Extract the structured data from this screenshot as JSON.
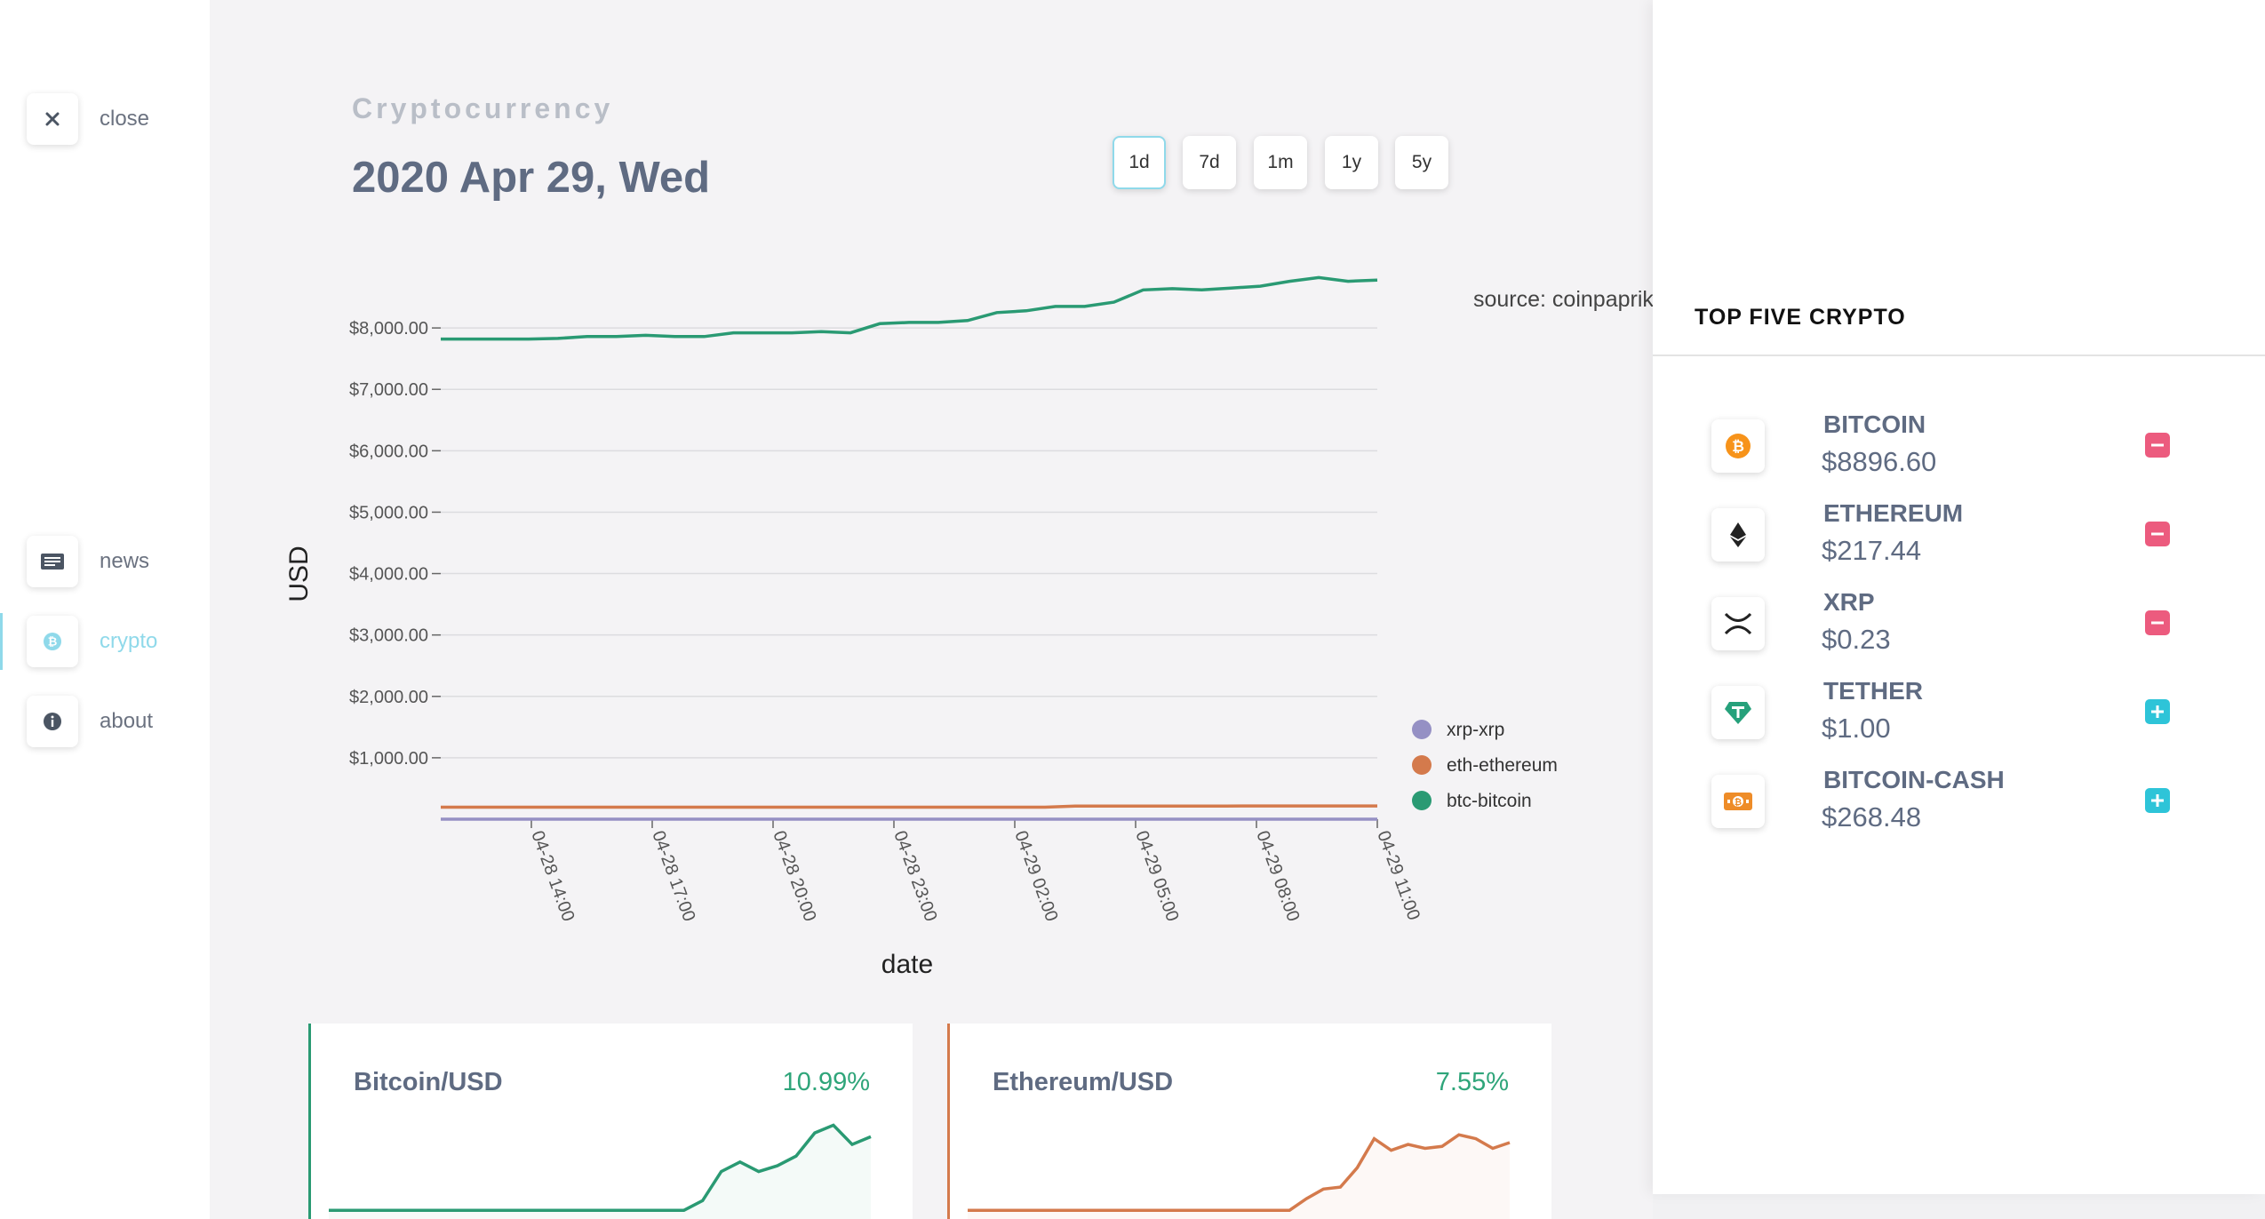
{
  "nav": {
    "close_label": "close",
    "items": [
      {
        "label": "news",
        "icon": "newspaper-icon"
      },
      {
        "label": "crypto",
        "icon": "bitcoin-icon",
        "active": true
      },
      {
        "label": "about",
        "icon": "info-icon"
      }
    ]
  },
  "header": {
    "section": "Cryptocurrency",
    "date": "2020 Apr 29, Wed"
  },
  "ranges": [
    "1d",
    "7d",
    "1m",
    "1y",
    "5y"
  ],
  "active_range": "1d",
  "chart_data": {
    "type": "line",
    "title": "",
    "source": "source: coinpaprika",
    "xlabel": "date",
    "ylabel": "USD",
    "yticks": [
      "$1,000.00",
      "$2,000.00",
      "$3,000.00",
      "$4,000.00",
      "$5,000.00",
      "$6,000.00",
      "$7,000.00",
      "$8,000.00"
    ],
    "ylim": [
      0,
      9000
    ],
    "xticks": [
      "04-28 14:00",
      "04-28 17:00",
      "04-28 20:00",
      "04-28 23:00",
      "04-29 02:00",
      "04-29 05:00",
      "04-29 08:00",
      "04-29 11:00"
    ],
    "grid": true,
    "legend_position": "right",
    "x_hours": [
      0,
      1,
      2,
      3,
      4,
      5,
      6,
      7,
      8,
      9,
      10,
      11,
      12,
      13,
      14,
      15,
      16,
      17,
      18,
      19,
      20,
      21,
      22,
      23,
      24,
      25,
      26,
      27,
      28,
      29,
      30,
      31
    ],
    "series": [
      {
        "name": "xrp-xrp",
        "color": "#9590c4",
        "values": [
          0.2,
          0.2,
          0.2,
          0.2,
          0.2,
          0.2,
          0.2,
          0.2,
          0.2,
          0.2,
          0.2,
          0.2,
          0.2,
          0.2,
          0.2,
          0.2,
          0.2,
          0.2,
          0.2,
          0.2,
          0.2,
          0.2,
          0.2,
          0.23,
          0.23,
          0.23,
          0.23,
          0.23,
          0.23,
          0.23,
          0.23,
          0.23
        ]
      },
      {
        "name": "eth-ethereum",
        "color": "#d47a4c",
        "values": [
          195,
          195,
          195,
          195,
          195,
          195,
          195,
          195,
          195,
          195,
          195,
          195,
          195,
          195,
          195,
          195,
          195,
          195,
          195,
          195,
          196,
          212,
          214,
          214,
          214,
          214,
          214,
          215,
          215,
          215,
          215,
          216
        ]
      },
      {
        "name": "btc-bitcoin",
        "color": "#2a9a73",
        "values": [
          7820,
          7820,
          7820,
          7820,
          7830,
          7860,
          7860,
          7880,
          7860,
          7860,
          7920,
          7920,
          7920,
          7940,
          7920,
          8070,
          8090,
          8090,
          8120,
          8250,
          8280,
          8350,
          8350,
          8420,
          8620,
          8640,
          8620,
          8650,
          8680,
          8760,
          8820,
          8760,
          8780
        ]
      }
    ]
  },
  "cards": [
    {
      "title": "Bitcoin/USD",
      "pct": "10.99%",
      "color": "#2a9a73",
      "spark": [
        1,
        1,
        1,
        1,
        1,
        1,
        1,
        1,
        1,
        1,
        1,
        1,
        1,
        1,
        1,
        1,
        1,
        1,
        1,
        1,
        1.5,
        3,
        3.5,
        3,
        3.3,
        3.8,
        5,
        5.4,
        4.4,
        4.8
      ]
    },
    {
      "title": "Ethereum/USD",
      "pct": "7.55%",
      "color": "#d47a4c",
      "spark": [
        1,
        1,
        1,
        1,
        1,
        1,
        1,
        1,
        1,
        1,
        1,
        1,
        1,
        1,
        1,
        1,
        1,
        1,
        1,
        1,
        1.6,
        2.1,
        2.2,
        3.2,
        4.7,
        4.1,
        4.4,
        4.2,
        4.3,
        4.9,
        4.7,
        4.2,
        4.5
      ]
    }
  ],
  "right_panel": {
    "title": "TOP FIVE CRYPTO",
    "coins": [
      {
        "name": "BITCOIN",
        "price": "$8896.60",
        "icon": "bitcoin-icon",
        "action": "remove"
      },
      {
        "name": "ETHEREUM",
        "price": "$217.44",
        "icon": "ethereum-icon",
        "action": "remove"
      },
      {
        "name": "XRP",
        "price": "$0.23",
        "icon": "xrp-icon",
        "action": "remove"
      },
      {
        "name": "TETHER",
        "price": "$1.00",
        "icon": "tether-icon",
        "action": "add"
      },
      {
        "name": "BITCOIN-CASH",
        "price": "$268.48",
        "icon": "bitcoin-cash-icon",
        "action": "add"
      }
    ]
  }
}
